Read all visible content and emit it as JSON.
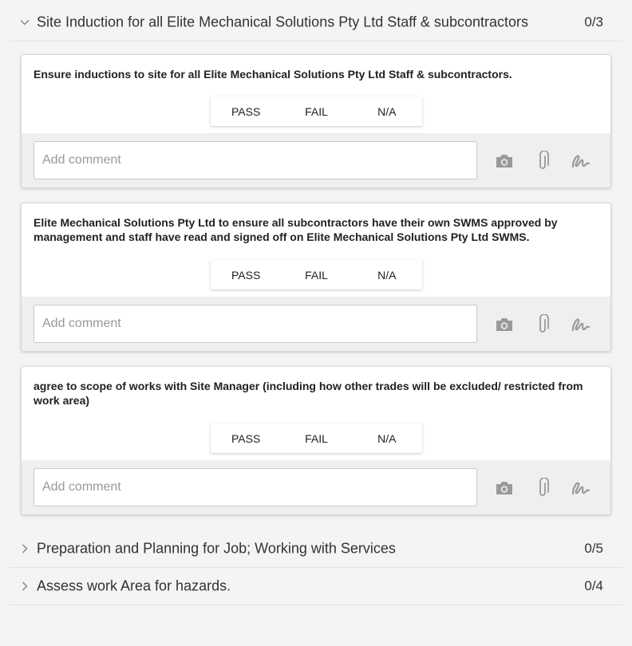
{
  "sections": [
    {
      "title": "Site Induction for all Elite Mechanical Solutions Pty Ltd Staff & subcontractors",
      "count": "0/3",
      "expanded": true
    },
    {
      "title": "Preparation and Planning for Job; Working with Services",
      "count": "0/5",
      "expanded": false
    },
    {
      "title": "Assess work Area for hazards.",
      "count": "0/4",
      "expanded": false
    }
  ],
  "questions": [
    {
      "text": "Ensure inductions to site for all Elite Mechanical Solutions Pty Ltd Staff & subcontractors.",
      "options": [
        "PASS",
        "FAIL",
        "N/A"
      ],
      "comment_placeholder": "Add comment"
    },
    {
      "text": "Elite Mechanical Solutions Pty Ltd to ensure all subcontractors have their own SWMS approved by management and staff have read and signed off on Elite Mechanical Solutions Pty Ltd SWMS.",
      "options": [
        "PASS",
        "FAIL",
        "N/A"
      ],
      "comment_placeholder": "Add comment"
    },
    {
      "text": "agree to scope of works with Site Manager (including how other trades will be excluded/ restricted from work area)",
      "options": [
        "PASS",
        "FAIL",
        "N/A"
      ],
      "comment_placeholder": "Add comment"
    }
  ],
  "icons": {
    "expanded": "chevron-down-icon",
    "collapsed": "chevron-right-icon",
    "camera": "camera-icon",
    "attach": "paperclip-icon",
    "sign": "signature-icon"
  },
  "colors": {
    "icon_gray": "#9a9a9a",
    "footer_bg": "#efefef",
    "page_bg": "#f4f4f4"
  }
}
